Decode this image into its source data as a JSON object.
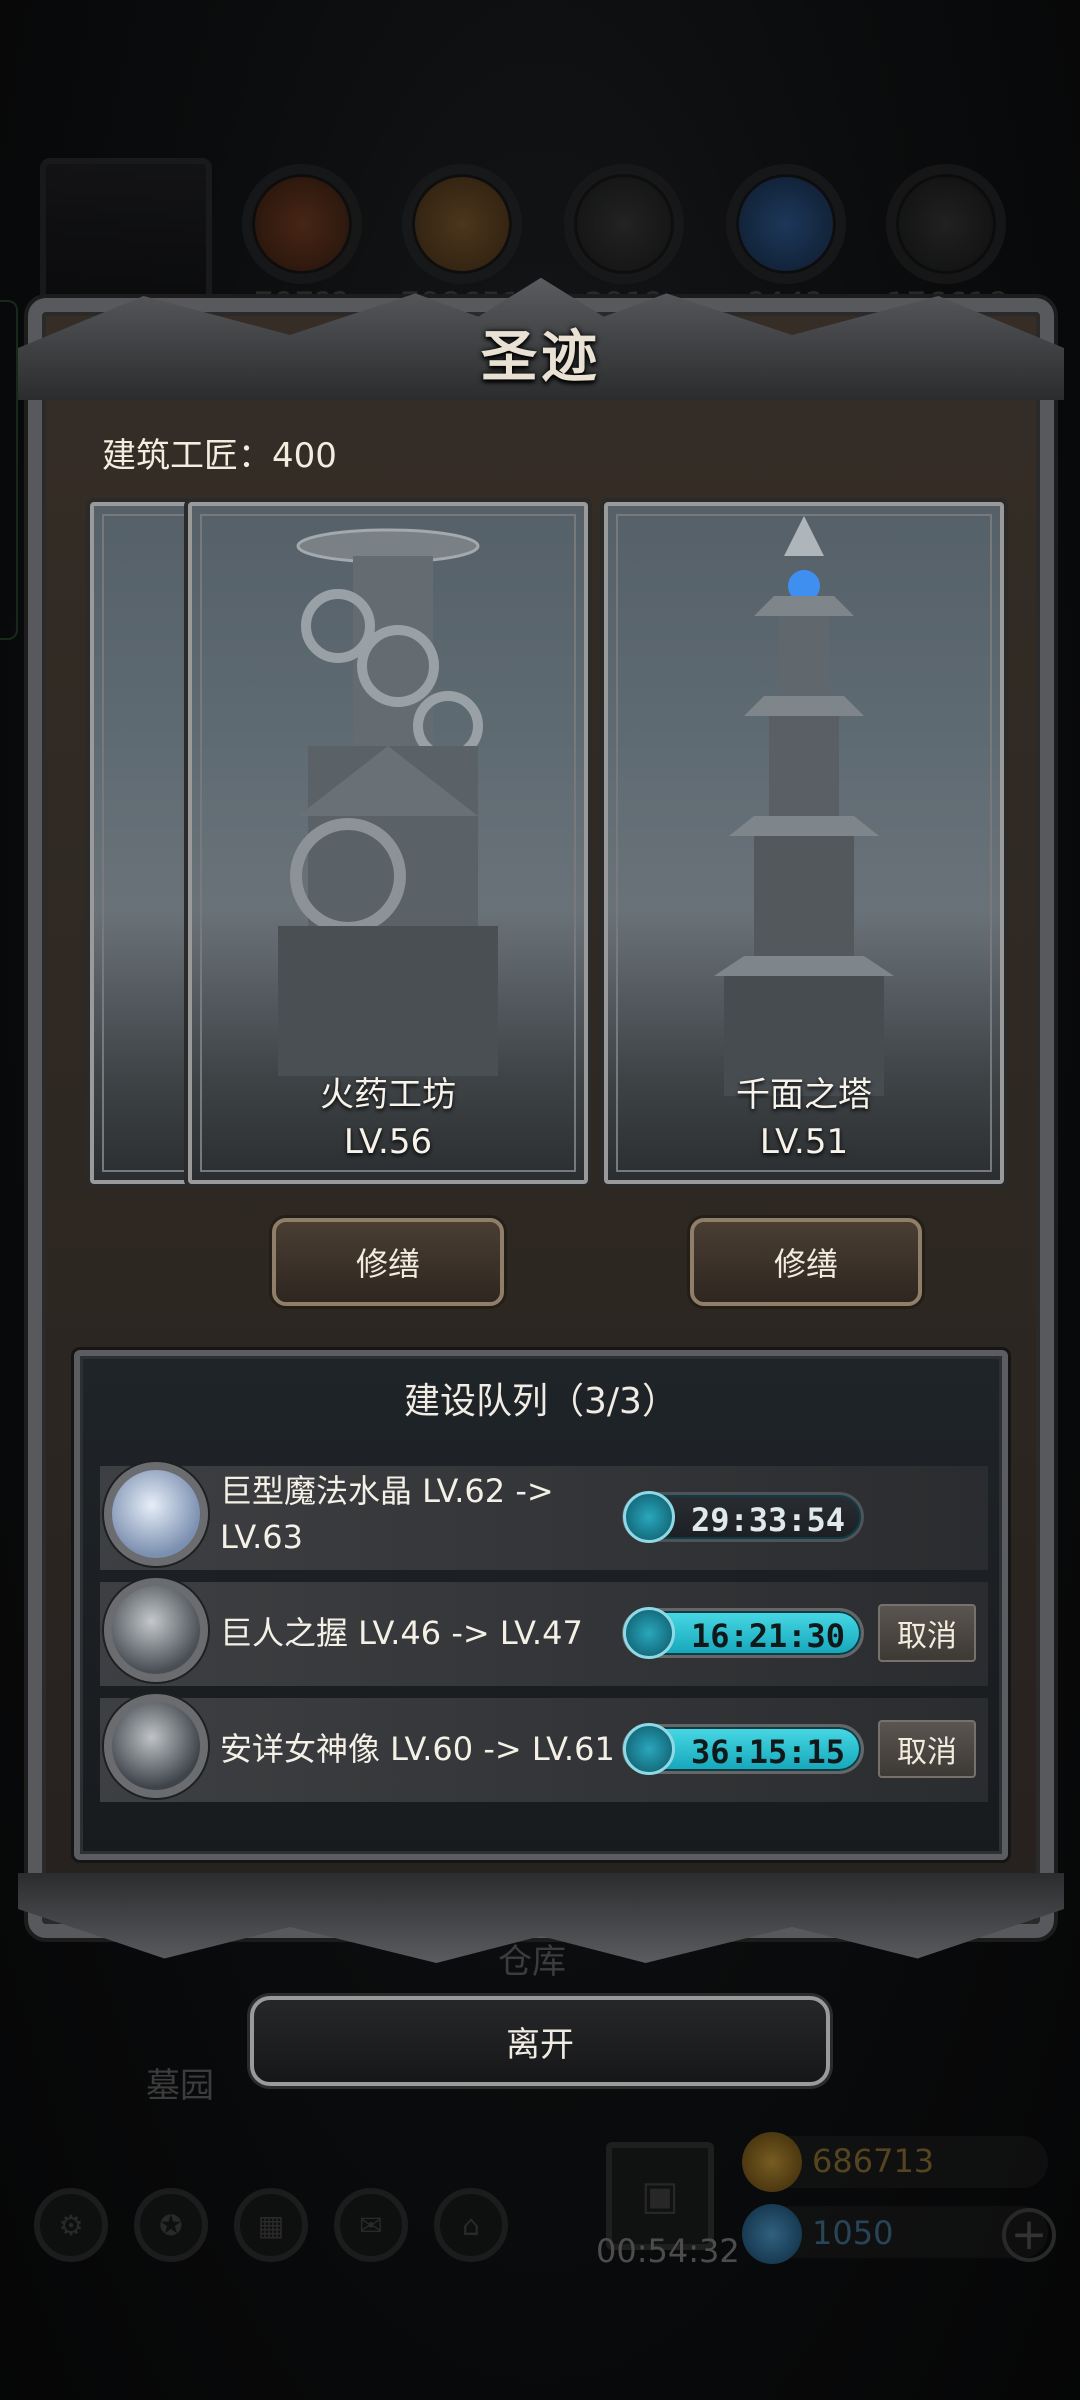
{
  "background": {
    "resources": [
      "797??",
      "798651",
      "391?",
      "?44?",
      "176618"
    ],
    "hud": {
      "warehouse_label": "仓库",
      "graveyard_label": "墓园",
      "gift_timer": "00:54:32",
      "gold": "686713",
      "gems": "1050"
    }
  },
  "dialog": {
    "title": "圣迹",
    "builders_label": "建筑工匠：400",
    "buildings": [
      {
        "name": "火药工坊",
        "level": "LV.56",
        "repair_label": "修缮"
      },
      {
        "name": "千面之塔",
        "level": "LV.51",
        "repair_label": "修缮"
      }
    ],
    "queue": {
      "title": "建设队列（3/3）",
      "items": [
        {
          "line1": "巨型魔法水晶 LV.62 ->",
          "line2": "LV.63",
          "timer": "29:33:54",
          "cancel_label": ""
        },
        {
          "line1": "巨人之握 LV.46 -> LV.47",
          "line2": "",
          "timer": "16:21:30",
          "cancel_label": "取消"
        },
        {
          "line1": "安详女神像 LV.60 -> LV.61",
          "line2": "",
          "timer": "36:15:15",
          "cancel_label": "取消"
        }
      ]
    },
    "leave_label": "离开"
  },
  "colors": {
    "timer_fill": "#1fb7c9",
    "frame": "#57595c",
    "panel": "#2d2722"
  }
}
